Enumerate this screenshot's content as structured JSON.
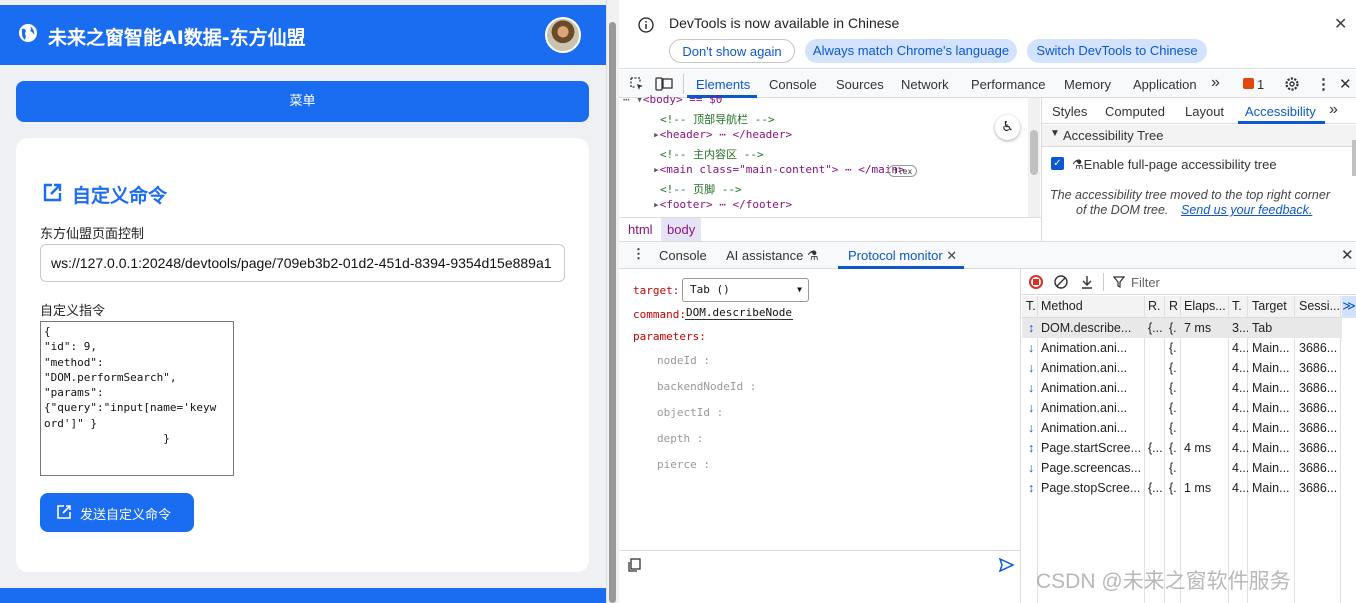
{
  "app": {
    "title": "未来之窗智能AI数据-东方仙盟",
    "menu_label": "菜单",
    "card_title": "自定义命令",
    "page_control_label": "东方仙盟页面控制",
    "ws_value": "ws://127.0.0.1:20248/devtools/page/709eb3b2-01d2-451d-8394-9354d15e889a1",
    "custom_cmd_label": "自定义指令",
    "custom_cmd_value": "{\n\"id\": 9,\n\"method\":\n\"DOM.performSearch\",\n\"params\":\n{\"query\":\"input[name='keyw\nord']\" }\n                  }",
    "send_label": "发送自定义命令",
    "accent": "#1a6cf0"
  },
  "devtools": {
    "infobar_text": "DevTools is now available in Chinese",
    "btn_dont_show": "Don't show again",
    "btn_match_lang": "Always match Chrome's language",
    "btn_switch": "Switch DevTools to Chinese",
    "tabs": [
      "Elements",
      "Console",
      "Sources",
      "Network",
      "Performance",
      "Memory",
      "Application"
    ],
    "issues_count": "1",
    "dom_lines": [
      "<body> == $0",
      "<!-- 顶部导航栏 -->",
      "<header> ⋯ </header>",
      "<!-- 主内容区 -->",
      "<main class=\"main-content\"> ⋯ </main>",
      "<!-- 页脚 -->",
      "<footer> ⋯ </footer>"
    ],
    "flex_badge": "flex",
    "breadcrumbs": [
      "html",
      "body"
    ],
    "side_tabs": [
      "Styles",
      "Computed",
      "Layout",
      "Accessibility"
    ],
    "a11y_tree_header": "Accessibility Tree",
    "a11y_checkbox_label": "Enable full-page accessibility tree",
    "a11y_note": "The accessibility tree moved to the top right corner",
    "a11y_note2": "of the DOM tree.",
    "a11y_link": "Send us your feedback.",
    "drawer_tabs": [
      "Console",
      "AI assistance",
      "Protocol monitor"
    ],
    "pm": {
      "target_label": "target:",
      "target_value": "Tab ()",
      "command_label": "command:",
      "command_value": "DOM.describeNode",
      "parameters_label": "parameters:",
      "params": [
        "nodeId",
        "backendNodeId",
        "objectId",
        "depth",
        "pierce"
      ]
    },
    "filter_placeholder": "Filter",
    "columns": [
      "T.",
      "Method",
      "R.",
      "R",
      "Elaps...",
      "T.",
      "Target",
      "Sessi..."
    ],
    "rows": [
      {
        "dir": "↕",
        "method": "DOM.describe...",
        "r1": "{...",
        "r2": "{.",
        "elapsed": "7 ms",
        "t": "3...",
        "target": "Tab",
        "session": ""
      },
      {
        "dir": "↓",
        "method": "Animation.ani...",
        "r1": "",
        "r2": "{.",
        "elapsed": "",
        "t": "4...",
        "target": "Main...",
        "session": "3686..."
      },
      {
        "dir": "↓",
        "method": "Animation.ani...",
        "r1": "",
        "r2": "{.",
        "elapsed": "",
        "t": "4...",
        "target": "Main...",
        "session": "3686..."
      },
      {
        "dir": "↓",
        "method": "Animation.ani...",
        "r1": "",
        "r2": "{.",
        "elapsed": "",
        "t": "4...",
        "target": "Main...",
        "session": "3686..."
      },
      {
        "dir": "↓",
        "method": "Animation.ani...",
        "r1": "",
        "r2": "{.",
        "elapsed": "",
        "t": "4...",
        "target": "Main...",
        "session": "3686..."
      },
      {
        "dir": "↓",
        "method": "Animation.ani...",
        "r1": "",
        "r2": "{.",
        "elapsed": "",
        "t": "4...",
        "target": "Main...",
        "session": "3686..."
      },
      {
        "dir": "↕",
        "method": "Page.startScree...",
        "r1": "{...",
        "r2": "{.",
        "elapsed": "4 ms",
        "t": "4...",
        "target": "Main...",
        "session": "3686..."
      },
      {
        "dir": "↓",
        "method": "Page.screencas...",
        "r1": "",
        "r2": "{.",
        "elapsed": "",
        "t": "4...",
        "target": "Main...",
        "session": "3686..."
      },
      {
        "dir": "↕",
        "method": "Page.stopScree...",
        "r1": "{...",
        "r2": "{.",
        "elapsed": "1 ms",
        "t": "4...",
        "target": "Main...",
        "session": "3686..."
      }
    ],
    "accent": "#0b57d0"
  },
  "watermark": "CSDN @未来之窗软件服务"
}
